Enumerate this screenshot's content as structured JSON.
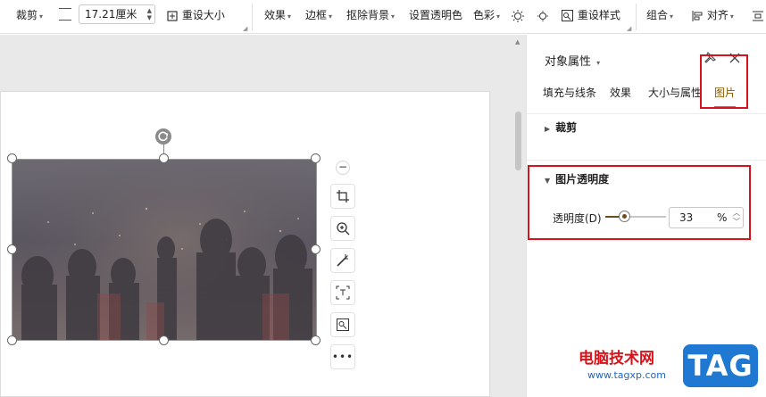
{
  "ribbon": {
    "crop_label": "裁剪",
    "size_value": "17.21厘米",
    "reset_size_label": "重设大小",
    "effects_label": "效果",
    "border_label": "边框",
    "remove_bg_label": "抠除背景",
    "set_transparent_label": "设置透明色",
    "color_label": "色彩",
    "reset_style_label": "重设样式",
    "group_label": "组合",
    "align_label": "对齐"
  },
  "panel": {
    "title": "对象属性",
    "tabs": [
      {
        "label": "填充与线条"
      },
      {
        "label": "效果"
      },
      {
        "label": "大小与属性"
      },
      {
        "label": "图片"
      }
    ],
    "active_tab": "图片",
    "crop_section": "裁剪",
    "transparency_section": "图片透明度",
    "transparency_label": "透明度(D)",
    "transparency_value": "33",
    "transparency_unit": "%",
    "transparency_fraction": 0.33
  },
  "watermark": {
    "site_name": "电脑技术网",
    "url": "www.tagxp.com",
    "logo": "TAG"
  },
  "colors": {
    "accent": "#a87b2b",
    "highlight": "#d8121a",
    "logo_bg": "#1f78d1"
  }
}
